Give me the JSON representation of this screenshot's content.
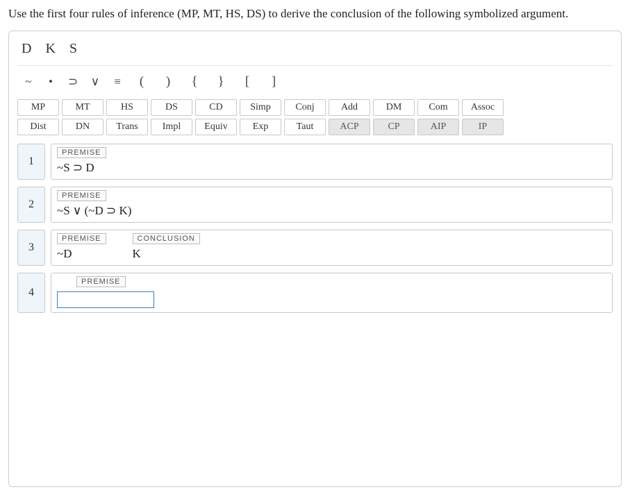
{
  "instructions": "Use the first four rules of inference (MP, MT, HS, DS) to derive the conclusion of the following symbolized argument.",
  "vars": [
    "D",
    "K",
    "S"
  ],
  "symbols": [
    "~",
    "•",
    "⊃",
    "∨",
    "≡",
    "(",
    ")",
    "{",
    "}",
    "[",
    "]"
  ],
  "rules_row1": [
    "MP",
    "MT",
    "HS",
    "DS",
    "CD",
    "Simp",
    "Conj",
    "Add",
    "DM",
    "Com",
    "Assoc"
  ],
  "rules_row2": [
    "Dist",
    "DN",
    "Trans",
    "Impl",
    "Equiv",
    "Exp",
    "Taut",
    "ACP",
    "CP",
    "AIP",
    "IP"
  ],
  "shaded_rules": [
    "ACP",
    "CP",
    "AIP",
    "IP"
  ],
  "lines": {
    "l1": {
      "num": "1",
      "tag": "PREMISE",
      "formula": "~S ⊃ D"
    },
    "l2": {
      "num": "2",
      "tag": "PREMISE",
      "formula": "~S ∨ (~D ⊃ K)"
    },
    "l3": {
      "num": "3",
      "tag": "PREMISE",
      "formula": "~D",
      "concl_tag": "CONCLUSION",
      "concl_formula": "K"
    },
    "l4": {
      "num": "4",
      "tag": "PREMISE",
      "input_value": ""
    }
  }
}
